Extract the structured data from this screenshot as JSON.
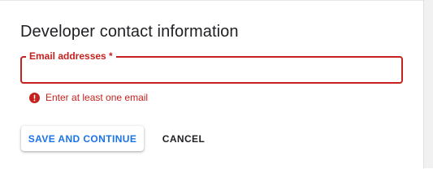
{
  "section": {
    "title": "Developer contact information"
  },
  "email_field": {
    "label": "Email addresses *",
    "value": "",
    "error": "Enter at least one email"
  },
  "actions": {
    "save_label": "SAVE AND CONTINUE",
    "cancel_label": "CANCEL"
  },
  "colors": {
    "error": "#c5221f",
    "primary": "#1a73e8",
    "text": "#202124"
  },
  "icons": {
    "error": "error-circle-icon"
  }
}
